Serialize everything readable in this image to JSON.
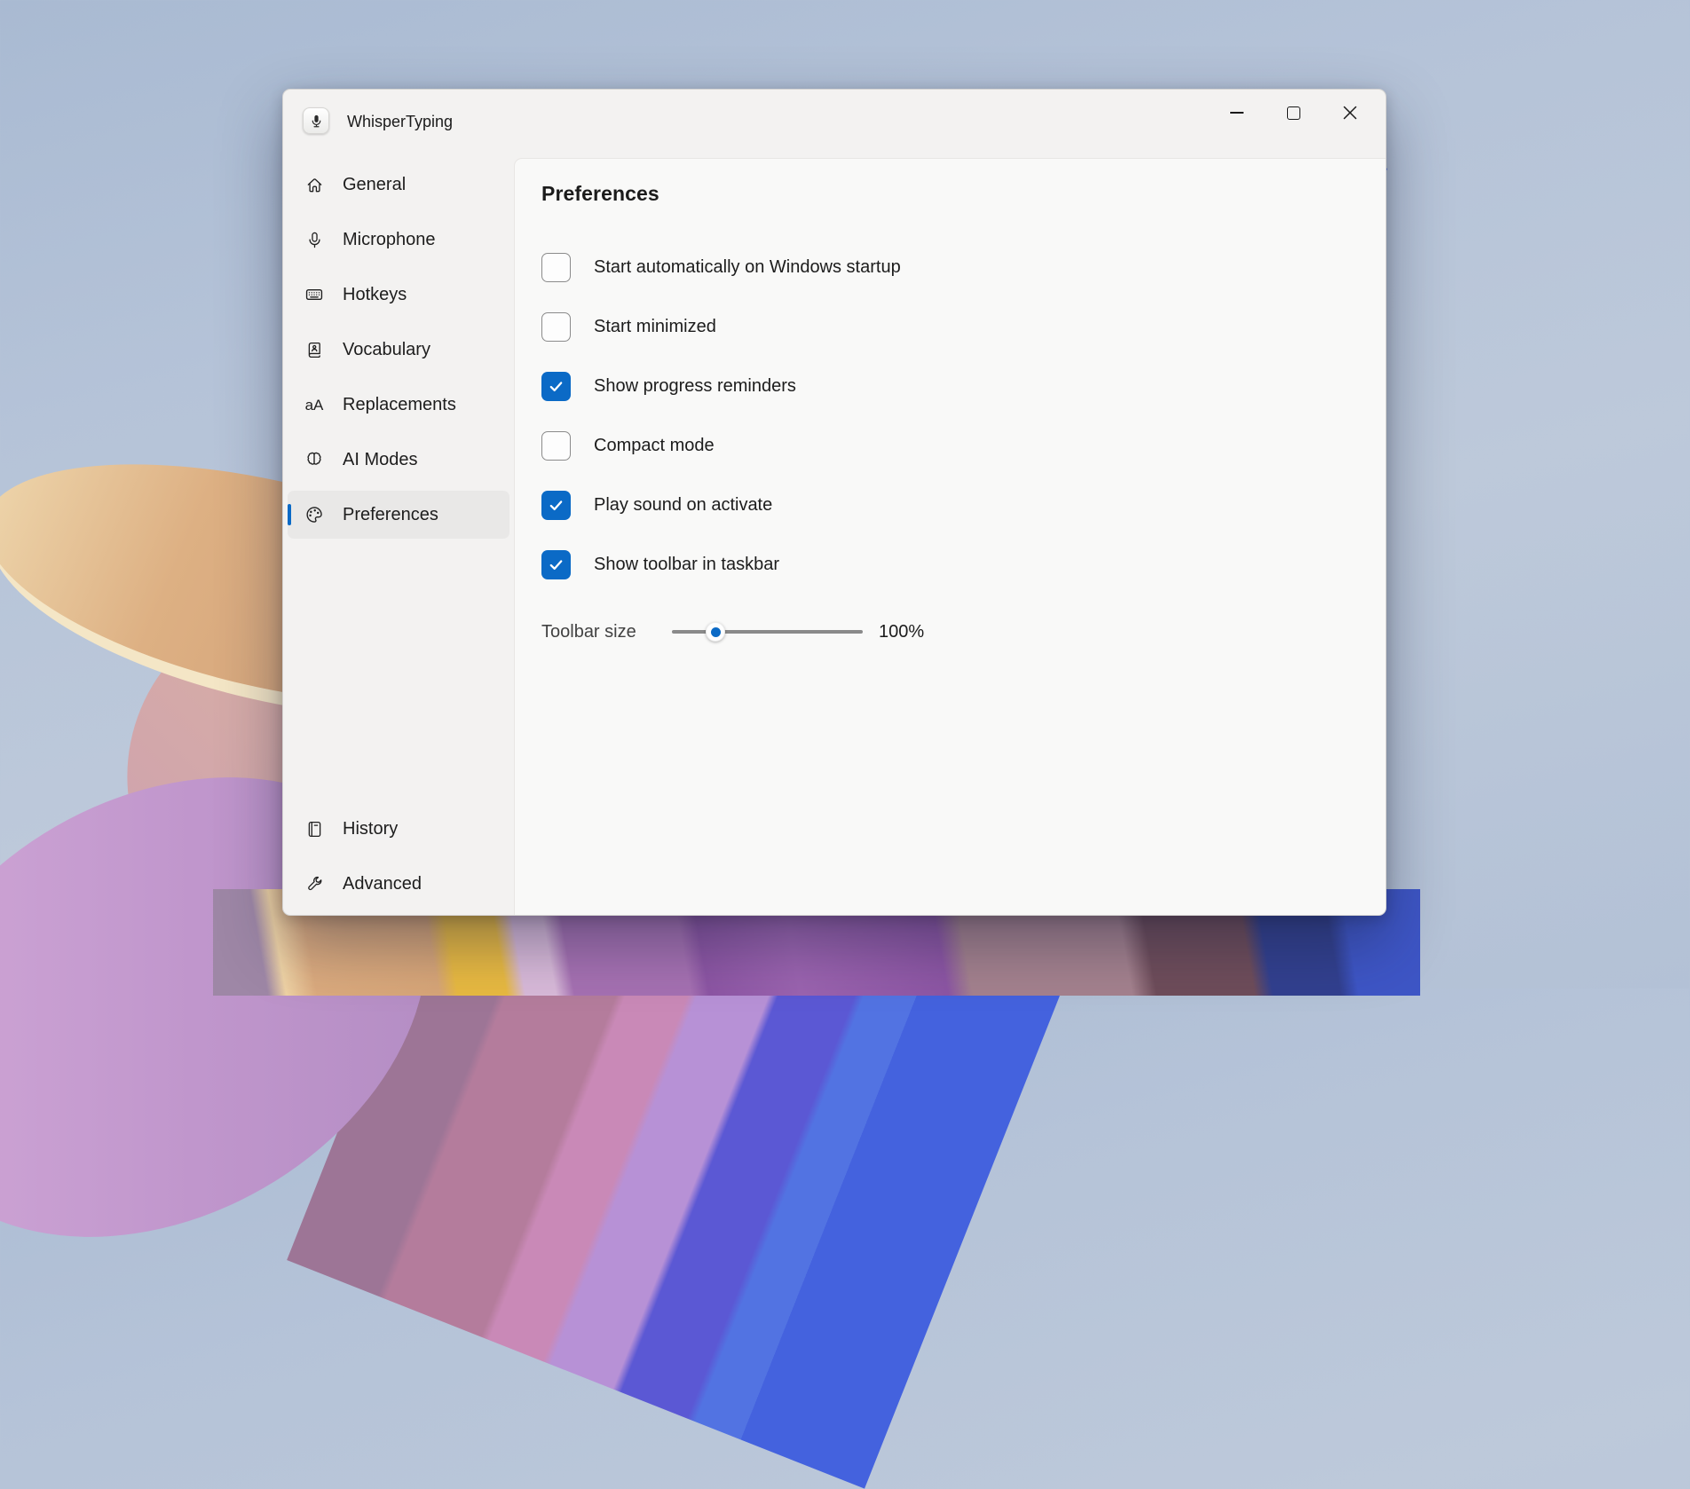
{
  "app": {
    "title": "WhisperTyping"
  },
  "titlebar": {
    "controls": [
      {
        "name": "minimize"
      },
      {
        "name": "maximize"
      },
      {
        "name": "close"
      }
    ]
  },
  "sidebar": {
    "items": [
      {
        "label": "General",
        "icon": "home",
        "selected": false
      },
      {
        "label": "Microphone",
        "icon": "microphone",
        "selected": false
      },
      {
        "label": "Hotkeys",
        "icon": "keyboard",
        "selected": false
      },
      {
        "label": "Vocabulary",
        "icon": "vocabulary",
        "selected": false
      },
      {
        "label": "Replacements",
        "icon": "replace",
        "selected": false
      },
      {
        "label": "AI Modes",
        "icon": "brain",
        "selected": false
      },
      {
        "label": "Preferences",
        "icon": "palette",
        "selected": true
      }
    ],
    "bottom_items": [
      {
        "label": "History",
        "icon": "history",
        "selected": false
      },
      {
        "label": "Advanced",
        "icon": "wrench",
        "selected": false
      }
    ]
  },
  "main": {
    "heading": "Preferences",
    "checkboxes": [
      {
        "label": "Start automatically on Windows startup",
        "checked": false
      },
      {
        "label": "Start minimized",
        "checked": false
      },
      {
        "label": "Show progress reminders",
        "checked": true
      },
      {
        "label": "Compact mode",
        "checked": false
      },
      {
        "label": "Play sound on activate",
        "checked": true
      },
      {
        "label": "Show toolbar in taskbar",
        "checked": true
      }
    ],
    "slider": {
      "label": "Toolbar size",
      "value": "100%",
      "thumb_position_pct": 23
    }
  },
  "colors": {
    "accent": "#0b6ac6",
    "window_bg": "#f3f2f1",
    "panel_bg": "#f9f9f8",
    "selected_item_bg": "#e9e8e7"
  }
}
